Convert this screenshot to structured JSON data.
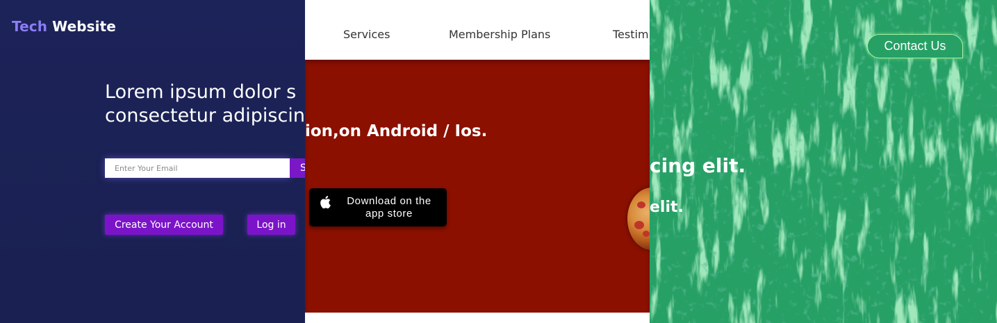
{
  "panel_navy": {
    "brand_part1": "Tech",
    "brand_part2": "Website",
    "heading_line1": "Lorem ipsum dolor s",
    "heading_line2": "consectetur adipiscin",
    "email_placeholder": "Enter Your Email",
    "subscribe_label": "S",
    "create_account_label": "Create Your Account",
    "login_label": "Log in",
    "colors": {
      "background": "#1c2358",
      "accent": "#7b14c8",
      "brand_accent": "#8b7cf5"
    }
  },
  "panel_red": {
    "nav": [
      "Services",
      "Membership Plans",
      "Testim"
    ],
    "heading": "ion,on Android / Ios.",
    "store_button_line1": "Download on the",
    "store_button_line2": "app store",
    "store_icon": "apple-icon",
    "colors": {
      "hero_bg": "#8b1000",
      "nav_bg": "#ffffff"
    }
  },
  "panel_green": {
    "heading": "cing elit.",
    "subheading": "elit.",
    "contact_label": "Contact Us",
    "colors": {
      "background": "#27a066",
      "button_border": "#a8f0a0"
    }
  }
}
